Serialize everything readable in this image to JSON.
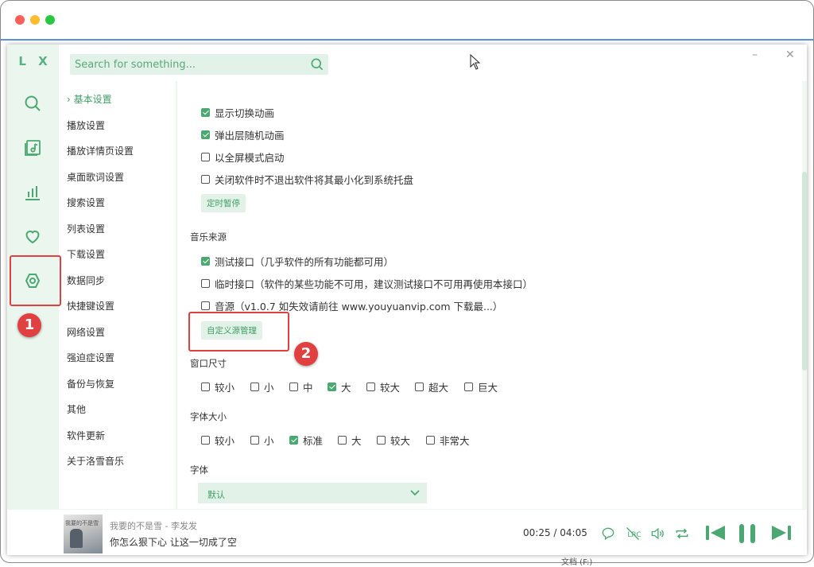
{
  "search": {
    "placeholder": "Search for something..."
  },
  "logo": "L X",
  "window_controls": {
    "minimize": "–",
    "close": "✕"
  },
  "nav": [
    {
      "name": "search-icon"
    },
    {
      "name": "music-list-icon"
    },
    {
      "name": "leaderboard-icon"
    },
    {
      "name": "heart-icon"
    },
    {
      "name": "settings-icon",
      "active": true
    }
  ],
  "settings_menu": [
    {
      "label": "基本设置",
      "active": true,
      "prefix": "›"
    },
    {
      "label": "播放设置"
    },
    {
      "label": "播放详情页设置"
    },
    {
      "label": "桌面歌词设置"
    },
    {
      "label": "搜索设置"
    },
    {
      "label": "列表设置"
    },
    {
      "label": "下载设置"
    },
    {
      "label": "数据同步"
    },
    {
      "label": "快捷键设置"
    },
    {
      "label": "网络设置"
    },
    {
      "label": "强迫症设置"
    },
    {
      "label": "备份与恢复"
    },
    {
      "label": "其他"
    },
    {
      "label": "软件更新"
    },
    {
      "label": "关于洛雪音乐"
    }
  ],
  "basic": {
    "options": [
      {
        "label": "显示切换动画",
        "checked": true
      },
      {
        "label": "弹出层随机动画",
        "checked": true
      },
      {
        "label": "以全屏模式启动",
        "checked": false
      },
      {
        "label": "关闭软件时不退出软件将其最小化到系统托盘",
        "checked": false
      }
    ],
    "timer_button": "定时暂停"
  },
  "music_source": {
    "title": "音乐来源",
    "options": [
      {
        "label": "测试接口（几乎软件的所有功能都可用）",
        "checked": true
      },
      {
        "label": "临时接口（软件的某些功能不可用，建议测试接口不可用再使用本接口）",
        "checked": false
      },
      {
        "label": "音源（v1.0.7 如失效请前往 www.youyuanvip.com 下载最...）",
        "checked": false
      }
    ],
    "custom_button": "自定义源管理"
  },
  "window_size": {
    "title": "窗口尺寸",
    "options": [
      {
        "label": "较小",
        "checked": false
      },
      {
        "label": "小",
        "checked": false
      },
      {
        "label": "中",
        "checked": false
      },
      {
        "label": "大",
        "checked": true
      },
      {
        "label": "较大",
        "checked": false
      },
      {
        "label": "超大",
        "checked": false
      },
      {
        "label": "巨大",
        "checked": false
      }
    ]
  },
  "font_size": {
    "title": "字体大小",
    "options": [
      {
        "label": "较小",
        "checked": false
      },
      {
        "label": "小",
        "checked": false
      },
      {
        "label": "标准",
        "checked": true
      },
      {
        "label": "大",
        "checked": false
      },
      {
        "label": "较大",
        "checked": false
      },
      {
        "label": "非常大",
        "checked": false
      }
    ]
  },
  "font": {
    "title": "字体",
    "selected": "默认"
  },
  "player": {
    "song": "我要的不是雪 - 李发发",
    "lyric": "你怎么狠下心 让这一切成了空",
    "time": "00:25 / 04:05",
    "album_text": "我要的不是雪"
  },
  "annotations": {
    "badge1": "1",
    "badge2": "2"
  },
  "bottom_peek": "文档 (F:)",
  "colors": {
    "accent": "#4aa870",
    "sidebar_bg": "#ebf6ef",
    "annotation": "#e14040"
  }
}
